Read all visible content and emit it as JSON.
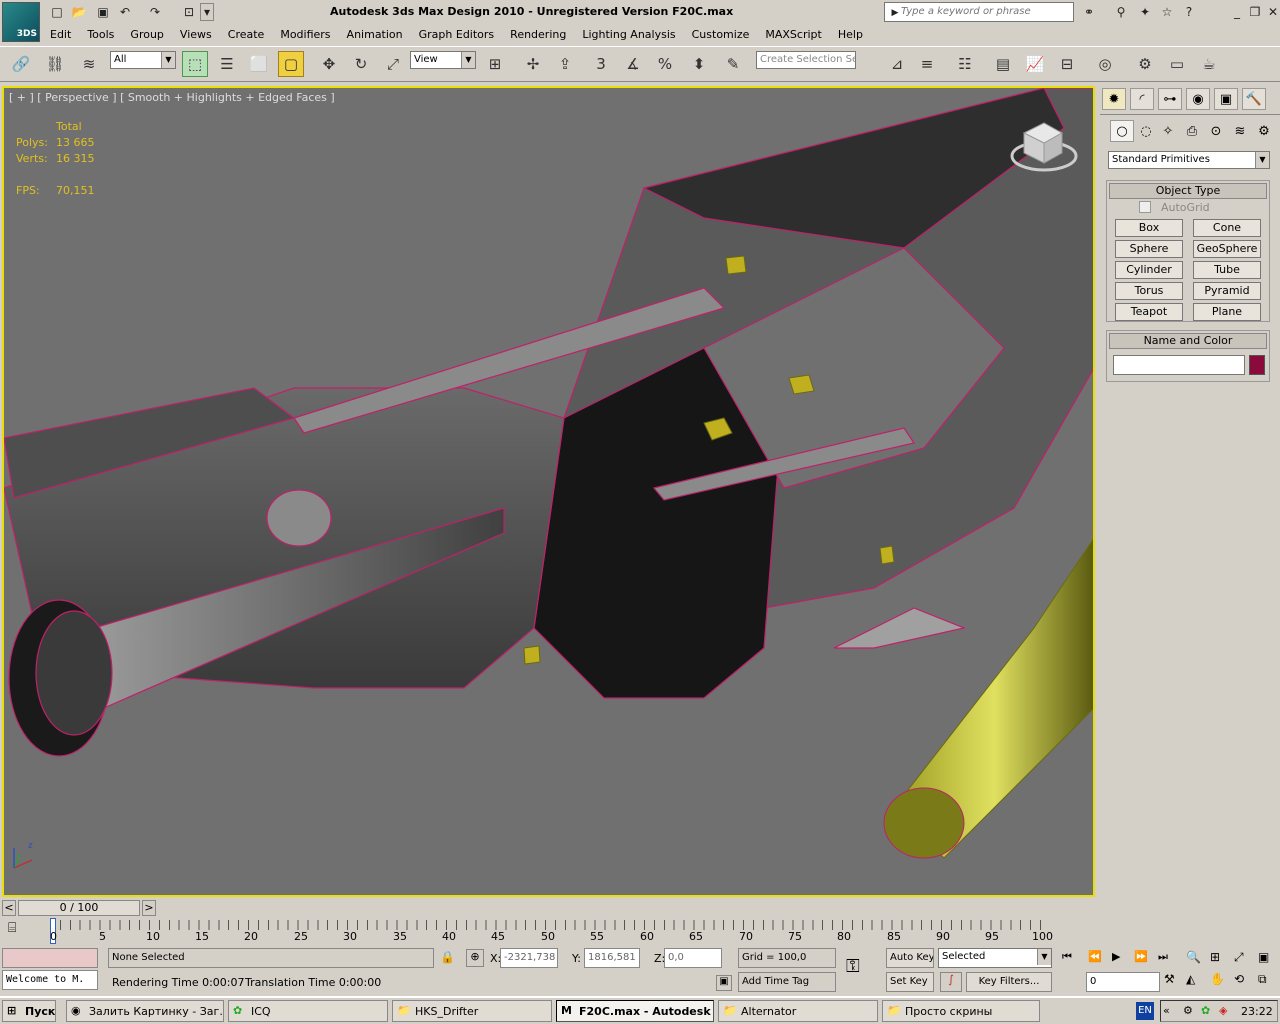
{
  "app": {
    "title": "Autodesk 3ds Max Design 2010  - Unregistered Version    F20C.max",
    "logo": "3DS"
  },
  "search": {
    "placeholder": "Type a keyword or phrase"
  },
  "menu": [
    "Edit",
    "Tools",
    "Group",
    "Views",
    "Create",
    "Modifiers",
    "Animation",
    "Graph Editors",
    "Rendering",
    "Lighting Analysis",
    "Customize",
    "MAXScript",
    "Help"
  ],
  "toolbar": {
    "filter_value": "All",
    "refcoord_value": "View",
    "selection_set_placeholder": "Create Selection Se",
    "snap_label": "3"
  },
  "viewport": {
    "label": "[ + ] [ Perspective ] [ Smooth + Highlights + Edged Faces ]",
    "stats_header": "Total",
    "polys_label": "Polys:",
    "polys_value": "13 665",
    "verts_label": "Verts:",
    "verts_value": "16 315",
    "fps_label": "FPS:",
    "fps_value": "70,151"
  },
  "command_panel": {
    "category_value": "Standard Primitives",
    "object_type_title": "Object Type",
    "autogrid_label": "AutoGrid",
    "buttons": [
      "Box",
      "Cone",
      "Sphere",
      "GeoSphere",
      "Cylinder",
      "Tube",
      "Torus",
      "Pyramid",
      "Teapot",
      "Plane"
    ],
    "name_color_title": "Name and Color",
    "object_color": "#8b0a3c"
  },
  "timeline": {
    "frame_indicator": "0 / 100",
    "ticks": [
      "0",
      "5",
      "10",
      "15",
      "20",
      "25",
      "30",
      "35",
      "40",
      "45",
      "50",
      "55",
      "60",
      "65",
      "70",
      "75",
      "80",
      "85",
      "90",
      "95",
      "100"
    ]
  },
  "status": {
    "maxscript_listener": "Welcome to M.",
    "selection": "None Selected",
    "prompt": "Rendering Time  0:00:07",
    "translation": "Translation Time  0:00:00",
    "x_label": "X:",
    "x_value": "-2321,738",
    "y_label": "Y:",
    "y_value": "1816,581",
    "z_label": "Z:",
    "z_value": "0,0",
    "grid": "Grid = 100,0",
    "add_time_tag": "Add Time Tag",
    "auto_key": "Auto Key",
    "set_key": "Set Key",
    "key_filter_value": "Selected",
    "key_filters": "Key Filters...",
    "current_frame": "0"
  },
  "taskbar": {
    "start": "Пуск",
    "tasks": [
      "Залить Картинку - Заг...",
      "ICQ",
      "HKS_Drifter",
      "F20C.max - Autodesk ...",
      "Alternator",
      "Просто скрины"
    ],
    "language": "EN",
    "clock": "23:22"
  }
}
